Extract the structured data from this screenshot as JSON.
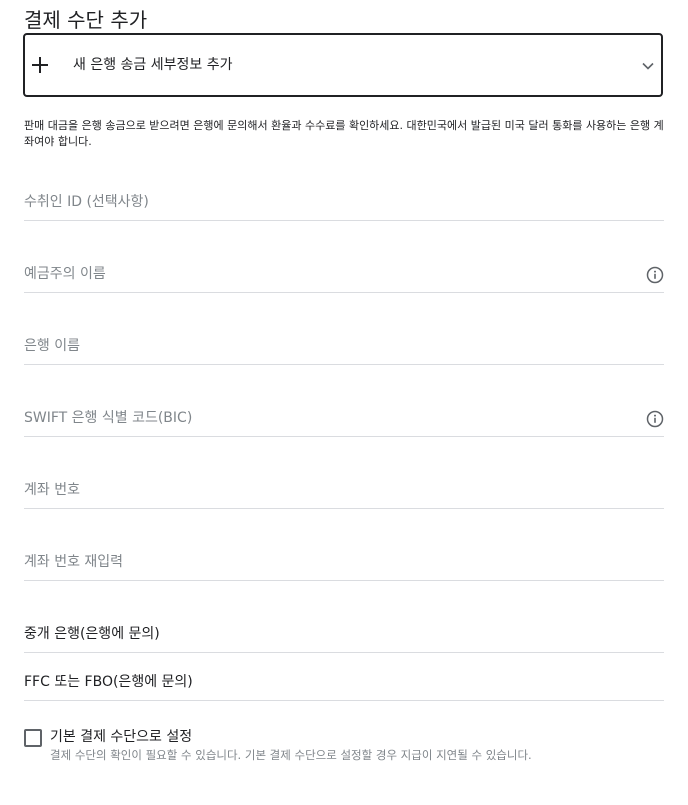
{
  "page": {
    "title": "결제 수단 추가"
  },
  "method_select": {
    "label": "새 은행 송금 세부정보 추가"
  },
  "notice": "판매 대금을 은행 송금으로 받으려면 은행에 문의해서 환율과 수수료를 확인하세요. 대한민국에서 발급된 미국 달러 통화를 사용하는 은행 계좌여야 합니다.",
  "fields": {
    "recipient_id": {
      "placeholder": "수취인 ID (선택사항)"
    },
    "account_holder": {
      "placeholder": "예금주의 이름",
      "icon": "info-icon"
    },
    "bank_name": {
      "placeholder": "은행 이름"
    },
    "swift": {
      "placeholder": "SWIFT 은행 식별 코드(BIC)",
      "icon": "info-icon"
    },
    "account_number": {
      "placeholder": "계좌 번호"
    },
    "account_number_confirm": {
      "placeholder": "계좌 번호 재입력"
    },
    "intermediary_bank": {
      "placeholder": "중개 은행(은행에 문의)"
    },
    "ffc_fbo": {
      "placeholder": "FFC 또는 FBO(은행에 문의)"
    }
  },
  "default_checkbox": {
    "label": "기본 결제 수단으로 설정",
    "help": "결제 수단의 확인이 필요할 수 있습니다. 기본 결제 수단으로 설정할 경우 지급이 지연될 수 있습니다.",
    "checked": false
  },
  "colors": {
    "text": "#202124",
    "placeholder": "#80868b",
    "divider": "#dadce0",
    "icon": "#5f6368"
  }
}
